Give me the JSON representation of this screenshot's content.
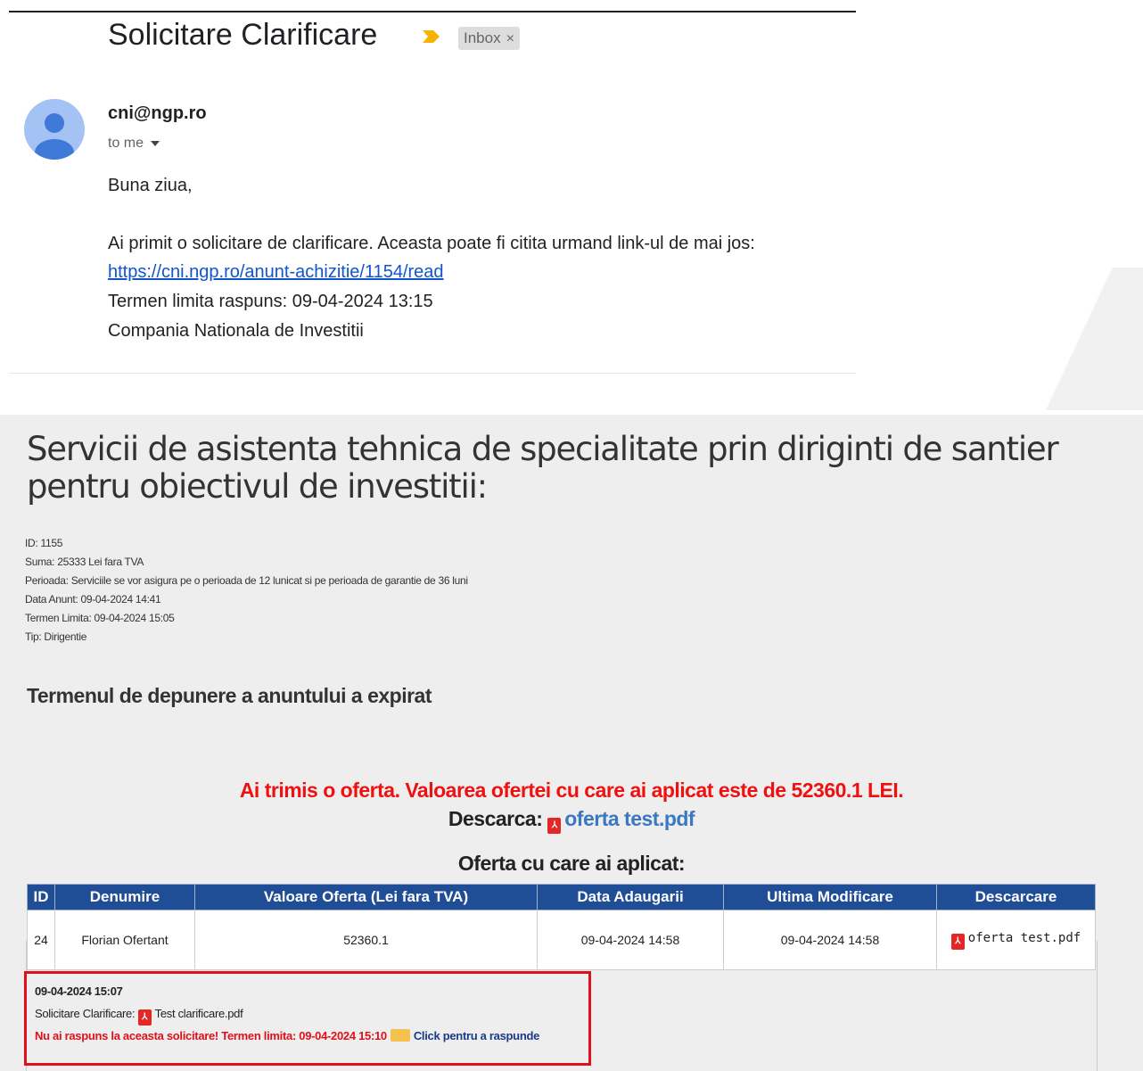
{
  "email": {
    "subject": "Solicitare Clarificare",
    "label": "Inbox",
    "label_close": "×",
    "sender": "cni@ngp.ro",
    "to": "to me",
    "greeting": "Buna ziua,",
    "line1": "Ai primit o solicitare de clarificare. Aceasta poate fi citita urmand link-ul de mai jos:",
    "link": "https://cni.ngp.ro/anunt-achizitie/1154/read",
    "deadline": "Termen limita raspuns: 09-04-2024 13:15",
    "signature": "Compania Nationala de Investitii"
  },
  "announcement": {
    "title": "Servicii de asistenta tehnica de specialitate prin diriginti de santier pentru obiectivul de investitii:",
    "meta": [
      "ID: 1155",
      "Suma: 25333 Lei fara TVA",
      "Perioada: Serviciile se vor asigura pe o perioada de 12 lunicat si pe perioada de garantie de 36 luni",
      "Data Anunt: 09-04-2024 14:41",
      "Termen Limita: 09-04-2024 15:05",
      "Tip: Dirigentie"
    ],
    "expired": "Termenul de depunere a anuntului a expirat",
    "sent_offer": "Ai trimis o oferta. Valoarea ofertei cu care ai aplicat este de 52360.1 LEI.",
    "download_label": "Descarca:",
    "download_file": "oferta test.pdf",
    "offer_heading": "Oferta cu care ai aplicat:",
    "table": {
      "headers": [
        "ID",
        "Denumire",
        "Valoare Oferta (Lei fara TVA)",
        "Data Adaugarii",
        "Ultima Modificare",
        "Descarcare"
      ],
      "row": {
        "id": "24",
        "name": "Florian Ofertant",
        "value": "52360.1",
        "added": "09-04-2024 14:58",
        "modified": "09-04-2024 14:58",
        "file": "oferta test.pdf"
      }
    },
    "clarification": {
      "date": "09-04-2024 15:07",
      "label": "Solicitare Clarificare:",
      "file": "Test clarificare.pdf",
      "warning": "Nu ai raspuns la aceasta solicitare! Termen limita: 09-04-2024 15:10",
      "reply_link": "Click pentru a raspunde"
    }
  },
  "icons": {
    "pdf": "pdf-icon",
    "reply": "reply-icon",
    "important": "importance-marker-icon",
    "avatar": "avatar-icon"
  },
  "colors": {
    "header_blue": "#1f4e96",
    "alert_red": "#e0101b",
    "link_blue": "#1155cc"
  }
}
